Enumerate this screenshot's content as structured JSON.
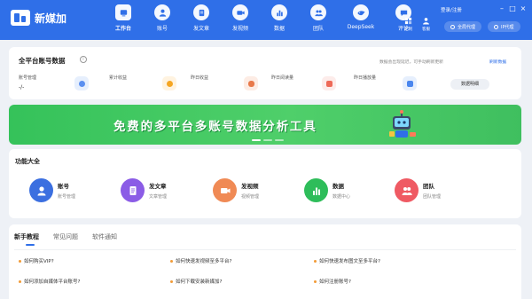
{
  "app": {
    "name": "新媒加"
  },
  "nav": [
    {
      "label": "工作台",
      "icon": "workbench-icon",
      "active": true
    },
    {
      "label": "账号",
      "icon": "account-icon"
    },
    {
      "label": "发文章",
      "icon": "article-icon"
    },
    {
      "label": "发视频",
      "icon": "video-icon"
    },
    {
      "label": "数据",
      "icon": "chart-icon"
    },
    {
      "label": "团队",
      "icon": "team-icon"
    },
    {
      "label": "DeepSeek",
      "icon": "deepseek-icon"
    },
    {
      "label": "评论",
      "icon": "comment-icon"
    }
  ],
  "top_right": {
    "login": "登录/注册",
    "customize": "定制",
    "support": "客服",
    "global_proxy": "全局代理",
    "ip_proxy": "IP代理"
  },
  "stats": {
    "title": "全平台账号数据",
    "note": "数据会出现延迟，可手动刷新更新",
    "refresh": "刷新数据",
    "items": [
      {
        "label": "账号管理",
        "value": "-/-"
      },
      {
        "label": "累计收益",
        "value": ""
      },
      {
        "label": "昨日收益",
        "value": ""
      },
      {
        "label": "昨日阅读量",
        "value": ""
      },
      {
        "label": "昨日播放量",
        "value": ""
      }
    ],
    "detail_button": "数据明细"
  },
  "banner": {
    "text": "免费的多平台多账号数据分析工具"
  },
  "functions": {
    "title": "功能大全",
    "items": [
      {
        "name": "账号",
        "desc": "账号管理",
        "icon": "user-icon",
        "color": "#3b6fe0"
      },
      {
        "name": "发文章",
        "desc": "文章管理",
        "icon": "document-icon",
        "color": "#8b5ce6"
      },
      {
        "name": "发视频",
        "desc": "视频管理",
        "icon": "video-camera-icon",
        "color": "#f08a55"
      },
      {
        "name": "数据",
        "desc": "数据中心",
        "icon": "bar-chart-icon",
        "color": "#2ebd5a"
      },
      {
        "name": "团队",
        "desc": "团队管理",
        "icon": "team-icon",
        "color": "#ef5a63"
      }
    ]
  },
  "tutorials": {
    "tabs": [
      "新手教程",
      "常见问题",
      "软件通知"
    ],
    "questions": [
      "如何购买VIP?",
      "如何快速发视频至多平台?",
      "如何快速发布图文至多平台?",
      "如何添加自媒体平台账号?",
      "如何下载安装新媒加?",
      "如何注册账号?"
    ]
  },
  "colors": {
    "primary": "#2f6fe8",
    "banner": "#4fcf6a",
    "bullet": "#f29b38"
  }
}
